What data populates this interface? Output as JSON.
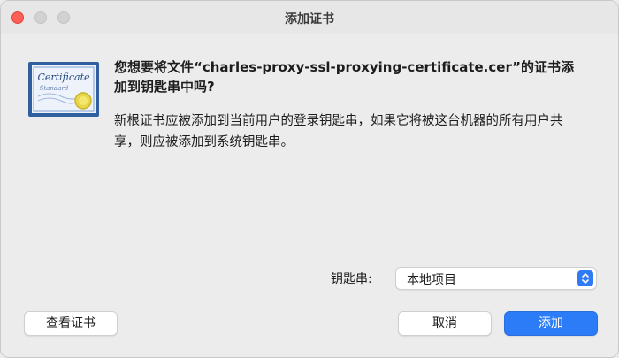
{
  "window": {
    "title": "添加证书"
  },
  "certificate": {
    "icon": "certificate-icon",
    "icon_text_1": "Certificate",
    "icon_text_2": "Standard"
  },
  "dialog": {
    "heading": "您想要将文件“charles-proxy-ssl-proxying-certificate.cer”的证书添加到钥匙串中吗?",
    "body": "新根证书应被添加到当前用户的登录钥匙串，如果它将被这台机器的所有用户共享，则应被添加到系统钥匙串。"
  },
  "keychain": {
    "label": "钥匙串:",
    "selected": "本地项目"
  },
  "buttons": {
    "view_certificate": "查看证书",
    "cancel": "取消",
    "add": "添加"
  },
  "colors": {
    "accent": "#2b7cf6",
    "close": "#ff5f57"
  }
}
